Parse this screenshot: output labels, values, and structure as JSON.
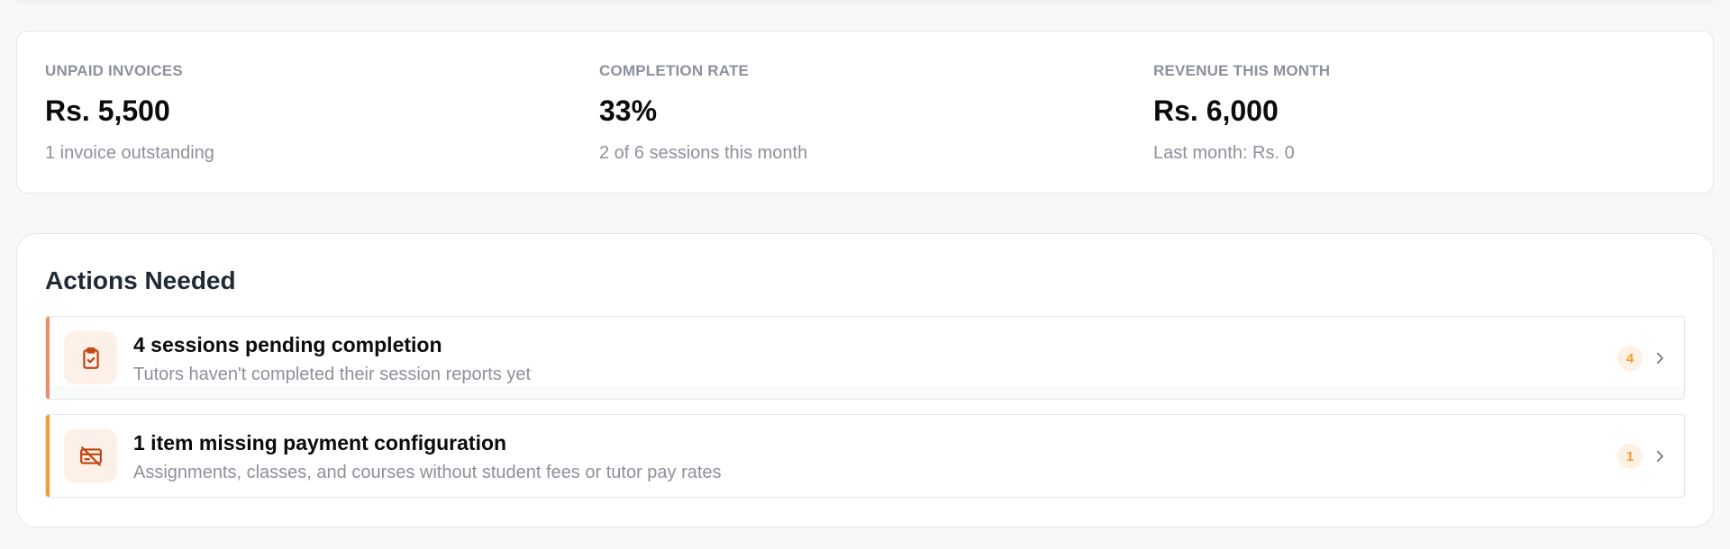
{
  "stats": [
    {
      "label": "UNPAID INVOICES",
      "value": "Rs. 5,500",
      "sub": "1 invoice outstanding"
    },
    {
      "label": "COMPLETION RATE",
      "value": "33%",
      "sub": "2 of 6 sessions this month"
    },
    {
      "label": "REVENUE THIS MONTH",
      "value": "Rs. 6,000",
      "sub": "Last month: Rs. 0"
    }
  ],
  "actions": {
    "title": "Actions Needed",
    "items": [
      {
        "title": "4 sessions pending completion",
        "description": "Tutors haven't completed their session reports yet",
        "count": "4",
        "icon": "clipboard-check-icon",
        "accent_color": "#ef8a6a"
      },
      {
        "title": "1 item missing payment configuration",
        "description": "Assignments, classes, and courses without student fees or tutor pay rates",
        "count": "1",
        "icon": "credit-card-off-icon",
        "accent_color": "#f59e2c"
      }
    ]
  },
  "colors": {
    "background": "#f7f8fa",
    "badge_text": "#f29a2e",
    "icon_stroke": "#c2410c",
    "muted_text": "#8b919c"
  }
}
